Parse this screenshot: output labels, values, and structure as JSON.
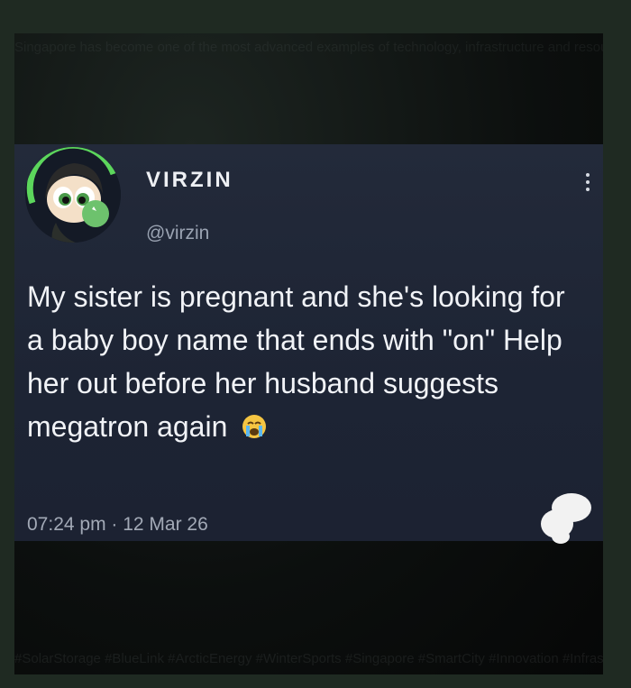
{
  "tweet": {
    "display_name": "VIRZIN",
    "handle": "@virzin",
    "text": "My sister is pregnant and she's looking for a baby boy name that ends with \"on\" Help her out before her husband suggests megatron again",
    "emoji": "crying-face",
    "timestamp": "07:24 pm · 12 Mar 26"
  },
  "background": {
    "top_text": "Singapore has become one of the most advanced examples of technology, infrastructure and resource management can completely transform a city-state. Despite having limited",
    "bottom_text": "#SolarStorage #BlueLink #ArcticEnergy #WinterSports #Singapore #SmartCity #Innovation #Infrastructure #Sustainability"
  },
  "colors": {
    "card_background": "#1f2636",
    "text": "#f1f3f7",
    "secondary_text": "#9aa3b2",
    "avatar_ring": "#5cd65c"
  }
}
